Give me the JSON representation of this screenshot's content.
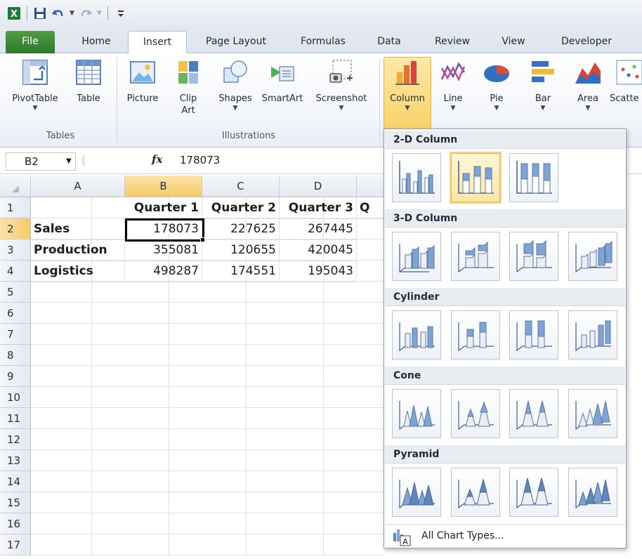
{
  "qat": {
    "icons": [
      "excel-logo-icon",
      "save-icon",
      "undo-icon",
      "redo-icon",
      "customize-icon"
    ]
  },
  "tabs": [
    "File",
    "Home",
    "Insert",
    "Page Layout",
    "Formulas",
    "Data",
    "Review",
    "View",
    "Developer"
  ],
  "ribbon": {
    "tables": {
      "label": "Tables",
      "pivot": "PivotTable",
      "table": "Table"
    },
    "illustrations": {
      "label": "Illustrations",
      "picture": "Picture",
      "clip_art_1": "Clip",
      "clip_art_2": "Art",
      "shapes": "Shapes",
      "smartart": "SmartArt",
      "screenshot": "Screenshot"
    },
    "charts": {
      "column": "Column",
      "line": "Line",
      "pie": "Pie",
      "bar": "Bar",
      "area": "Area",
      "scatter": "Scatte"
    }
  },
  "formula_bar": {
    "name_box": "B2",
    "fx": "fx",
    "value": "178073"
  },
  "sheet": {
    "columns": [
      "A",
      "B",
      "C",
      "D"
    ],
    "partial_col_text": "Q",
    "rows": [
      "1",
      "2",
      "3",
      "4",
      "5",
      "6",
      "7",
      "8",
      "9",
      "10",
      "11",
      "12",
      "13",
      "14",
      "15",
      "16",
      "17"
    ],
    "headers": [
      "Quarter 1",
      "Quarter 2",
      "Quarter 3"
    ],
    "data": [
      {
        "label": "Sales",
        "values": [
          "178073",
          "227625",
          "267445"
        ]
      },
      {
        "label": "Production",
        "values": [
          "355081",
          "120655",
          "420045"
        ]
      },
      {
        "label": "Logistics",
        "values": [
          "498287",
          "174551",
          "195043"
        ]
      }
    ]
  },
  "gallery": {
    "sections": [
      "2-D Column",
      "3-D Column",
      "Cylinder",
      "Cone",
      "Pyramid"
    ],
    "all_chart_types": "All Chart Types..."
  },
  "colors": {
    "file_tab": "#2f7a2b",
    "selection": "#f9d26a",
    "accent": "#1f5fa8"
  }
}
